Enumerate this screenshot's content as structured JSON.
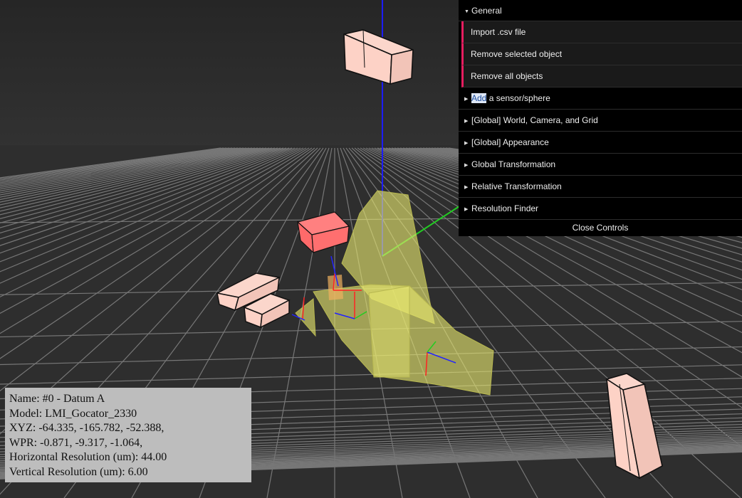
{
  "controls": {
    "general_folder": "General",
    "general_items": [
      "Import .csv file",
      "Remove selected object",
      "Remove all objects"
    ],
    "add_sensor": {
      "highlight": "Add",
      "rest": " a sensor/sphere"
    },
    "folders": [
      "[Global] World, Camera, and Grid",
      "[Global] Appearance",
      "Global Transformation",
      "Relative Transformation",
      "Resolution Finder"
    ],
    "close": "Close Controls"
  },
  "info": {
    "name": "Name: #0 - Datum A",
    "model": "Model: LMI_Gocator_2330",
    "xyz": "XYZ: -64.335, -165.782, -52.388,",
    "wpr": "WPR: -0.871, -9.317, -1.064,",
    "h_res": "Horizontal Resolution (um): 44.00",
    "v_res": "Vertical Resolution (um): 6.00"
  },
  "colors": {
    "background": "#2b2b2b",
    "grid": "#7a7a7a",
    "sensor_box": "#fdd2c6",
    "selected_box": "#ff6f6f",
    "scan_plane": "#e8e870",
    "axis_x": "#ff2020",
    "axis_y": "#20d020",
    "axis_z": "#2020ff",
    "panel_bg": "#000000",
    "button_accent": "#e61d5f",
    "info_bg": "#bdbdbd"
  }
}
